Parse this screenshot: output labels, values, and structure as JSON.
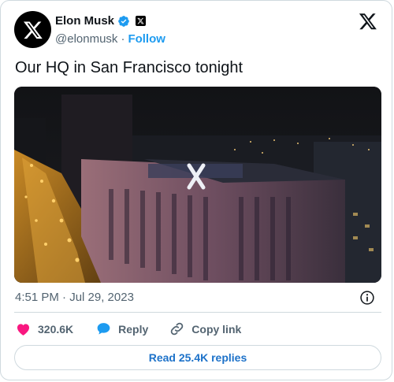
{
  "author": {
    "name": "Elon Musk",
    "handle": "@elonmusk",
    "separator": "·",
    "follow_label": "Follow"
  },
  "tweet": {
    "text": "Our HQ in San Francisco tonight",
    "timestamp": "4:51 PM · Jul 29, 2023"
  },
  "actions": {
    "likes_count": "320.6K",
    "reply_label": "Reply",
    "copy_link_label": "Copy link"
  },
  "read_replies_label": "Read 25.4K replies",
  "colors": {
    "accent": "#1d9bf0",
    "like": "#f91880",
    "text_secondary": "#536471",
    "border": "#cfd9de"
  },
  "icons": {
    "avatar": "x-logo-icon",
    "verified": "verified-badge-icon",
    "affiliation": "x-affiliation-icon",
    "brand": "x-logo-icon",
    "info": "info-icon",
    "like": "heart-icon",
    "reply": "speech-bubble-icon",
    "copy_link": "link-icon"
  }
}
